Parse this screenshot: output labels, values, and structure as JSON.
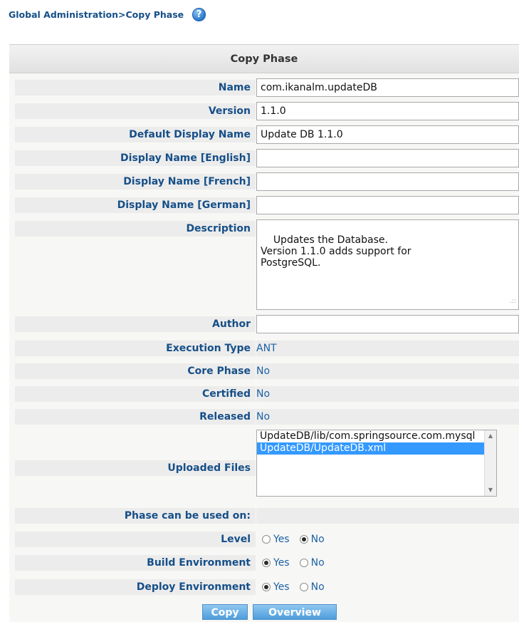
{
  "breadcrumb": "Global Administration>Copy Phase",
  "help_icon": "?",
  "panel_title": "Copy Phase",
  "fields": {
    "name": {
      "label": "Name",
      "value": "com.ikanalm.updateDB"
    },
    "version": {
      "label": "Version",
      "value": "1.1.0"
    },
    "default_display_name": {
      "label": "Default Display Name",
      "value": "Update DB 1.1.0"
    },
    "display_name_english": {
      "label": "Display Name [English]",
      "value": ""
    },
    "display_name_french": {
      "label": "Display Name [French]",
      "value": ""
    },
    "display_name_german": {
      "label": "Display Name [German]",
      "value": ""
    },
    "description": {
      "label": "Description",
      "value": "Updates the Database.\nVersion 1.1.0 adds support for\nPostgreSQL."
    },
    "author": {
      "label": "Author",
      "value": ""
    },
    "execution_type": {
      "label": "Execution Type",
      "value": "ANT"
    },
    "core_phase": {
      "label": "Core Phase",
      "value": "No"
    },
    "certified": {
      "label": "Certified",
      "value": "No"
    },
    "released": {
      "label": "Released",
      "value": "No"
    },
    "uploaded_files": {
      "label": "Uploaded Files",
      "items": [
        "UpdateDB/lib/com.springsource.com.mysql",
        "UpdateDB/UpdateDB.xml"
      ],
      "selected_index": 1
    }
  },
  "usage": {
    "heading": "Phase can be used on:",
    "yes_label": "Yes",
    "no_label": "No",
    "level": {
      "label": "Level",
      "selected": "No"
    },
    "build_environment": {
      "label": "Build Environment",
      "selected": "Yes"
    },
    "deploy_environment": {
      "label": "Deploy Environment",
      "selected": "Yes"
    }
  },
  "buttons": {
    "copy": "Copy",
    "overview": "Overview"
  },
  "colors": {
    "label": "#164F88",
    "value": "#1d62a7",
    "row_bg": "#ececec",
    "button": "#4e9ddc",
    "selection": "#3399ff"
  }
}
